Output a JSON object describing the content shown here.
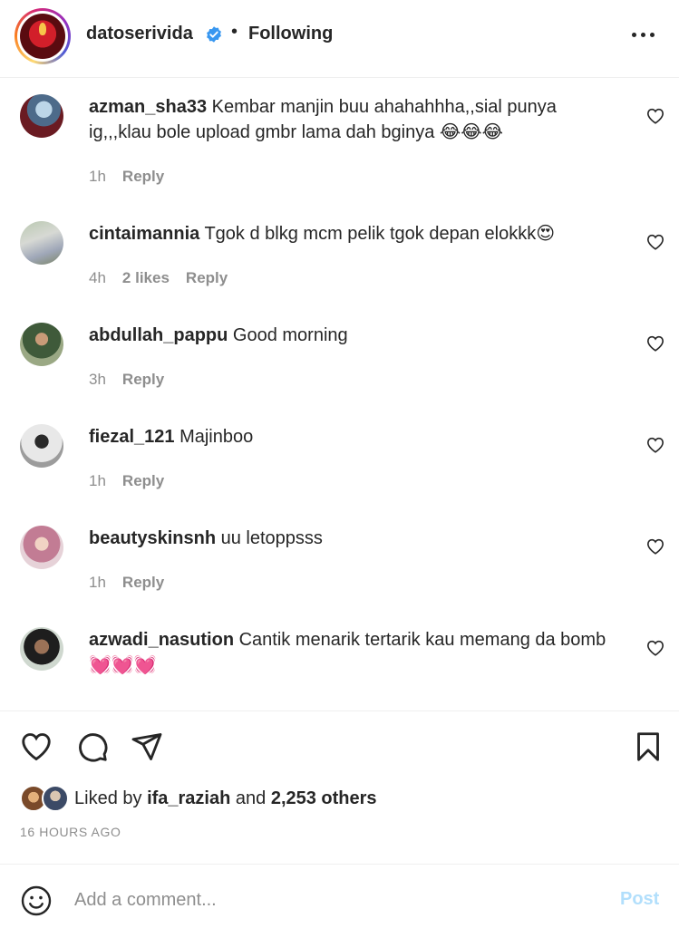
{
  "header": {
    "username": "datoserivida",
    "separator": "•",
    "follow_status": "Following"
  },
  "comments": [
    {
      "username": "azman_sha33",
      "text": "Kembar manjin buu ahahahhha,,sial punya ig,,,klau bole upload gmbr lama dah bginya 😂😂😂",
      "time": "1h",
      "likes": "",
      "reply": "Reply"
    },
    {
      "username": "cintaimannia",
      "text": "Tgok d blkg mcm pelik tgok depan elokkk😍",
      "time": "4h",
      "likes": "2 likes",
      "reply": "Reply"
    },
    {
      "username": "abdullah_pappu",
      "text": "Good morning",
      "time": "3h",
      "likes": "",
      "reply": "Reply"
    },
    {
      "username": "fiezal_121",
      "text": "Majinboo",
      "time": "1h",
      "likes": "",
      "reply": "Reply"
    },
    {
      "username": "beautyskinsnh",
      "text": "uu letoppsss",
      "time": "1h",
      "likes": "",
      "reply": "Reply"
    },
    {
      "username": "azwadi_nasution",
      "text": "Cantik menarik tertarik kau memang da bomb💓💓💓",
      "time": "",
      "likes": "",
      "reply": ""
    }
  ],
  "likes": {
    "prefix": "Liked by",
    "user": "ifa_raziah",
    "connector": "and",
    "others": "2,253 others"
  },
  "timestamp": "16 HOURS AGO",
  "add_comment": {
    "placeholder": "Add a comment...",
    "post_label": "Post"
  },
  "colors": {
    "verified": "#3897f0",
    "post_disabled": "#b2dffc",
    "secondary_text": "#8e8e8e"
  },
  "icons": [
    "verified-badge-icon",
    "more-options-icon",
    "heart-icon",
    "comment-icon",
    "share-icon",
    "bookmark-icon",
    "emoji-icon"
  ]
}
